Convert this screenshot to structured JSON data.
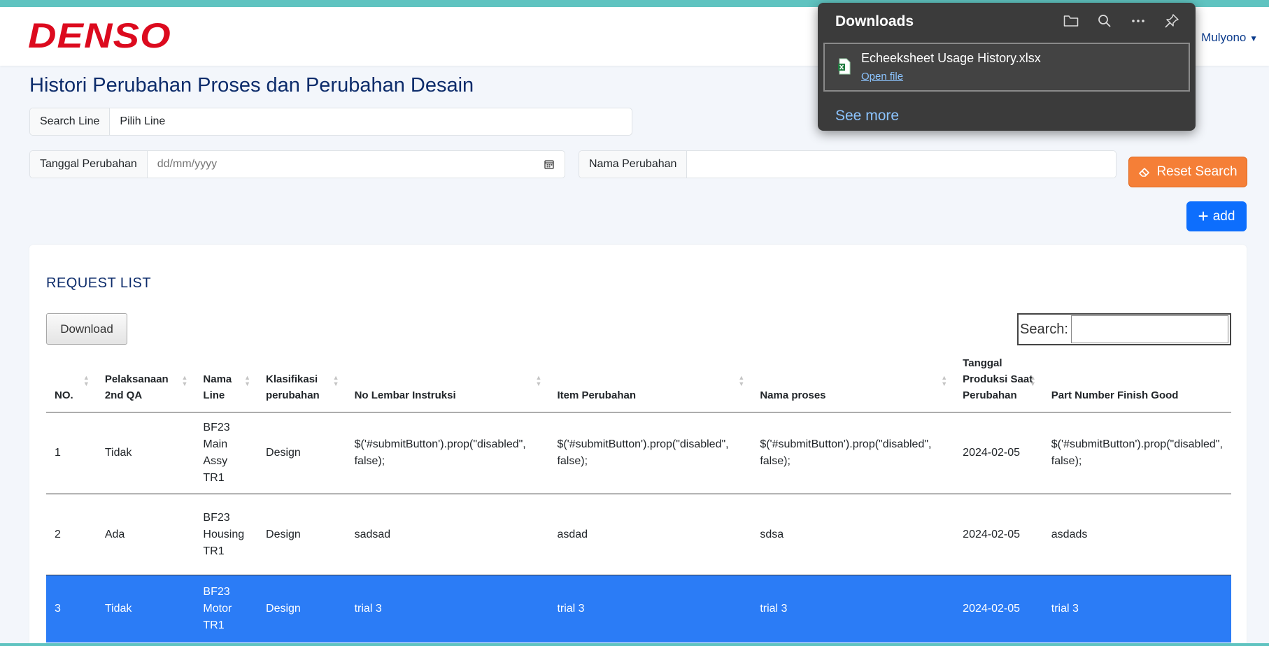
{
  "brand": {
    "logo_text": "DENSO",
    "logo_color": "#dc0a1e"
  },
  "user": {
    "name": "Mulyono"
  },
  "page": {
    "title": "Histori Perubahan Proses dan Perubahan Desain"
  },
  "filters": {
    "search_line_label": "Search Line",
    "search_line_value": "Pilih Line",
    "tanggal_label": "Tanggal Perubahan",
    "tanggal_placeholder": "dd/mm/yyyy",
    "nama_label": "Nama Perubahan",
    "nama_value": "",
    "reset_label": "Reset Search"
  },
  "actions": {
    "add_label": "add"
  },
  "card": {
    "title": "REQUEST LIST",
    "download_label": "Download",
    "search_label": "Search:"
  },
  "table": {
    "headers": [
      "NO.",
      "Pelaksanaan 2nd QA",
      "Nama Line",
      "Klasifikasi perubahan",
      "No Lembar Instruksi",
      "Item Perubahan",
      "Nama proses",
      "Tanggal Produksi Saat Perubahan",
      "Part Number Finish Good"
    ],
    "rows": [
      [
        "1",
        "Tidak",
        "BF23 Main Assy TR1",
        "Design",
        "$('#submitButton').prop(\"disabled\", false);",
        "$('#submitButton').prop(\"disabled\", false);",
        "$('#submitButton').prop(\"disabled\", false);",
        "2024-02-05",
        "$('#submitButton').prop(\"disabled\", false);"
      ],
      [
        "2",
        "Ada",
        "BF23 Housing TR1",
        "Design",
        "sadsad",
        "asdad",
        "sdsa",
        "2024-02-05",
        "asdads"
      ],
      [
        "3",
        "Tidak",
        "BF23 Motor TR1",
        "Design",
        "trial 3",
        "trial 3",
        "trial 3",
        "2024-02-05",
        "trial 3"
      ]
    ],
    "selected_row_index": 2,
    "selected_color": "#2b7cf6"
  },
  "downloads_panel": {
    "title": "Downloads",
    "file_name": "Echeeksheet Usage History.xlsx",
    "open_label": "Open file",
    "see_more_label": "See more",
    "icons": [
      "folder-icon",
      "search-icon",
      "more-icon",
      "pin-icon"
    ]
  }
}
